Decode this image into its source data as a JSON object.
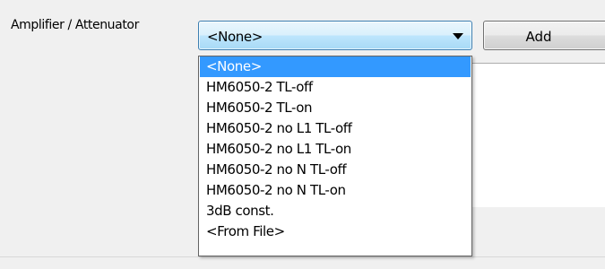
{
  "form": {
    "field_label": "Amplifier / Attenuator",
    "selected_value": "<None>",
    "add_label": "Add"
  },
  "dropdown": {
    "options": [
      "<None>",
      "HM6050-2 TL-off",
      "HM6050-2 TL-on",
      "HM6050-2 no L1 TL-off",
      "HM6050-2 no L1 TL-on",
      "HM6050-2 no N TL-off",
      "HM6050-2 no N TL-on",
      "3dB const.",
      "<From File>"
    ],
    "highlighted_index": 0
  },
  "colors": {
    "highlight": "#3399ff",
    "combo_border": "#3c7fb1",
    "panel_bg": "#f0f0f0"
  },
  "icons": {
    "dropdown_arrow": "chevron-down-icon"
  }
}
